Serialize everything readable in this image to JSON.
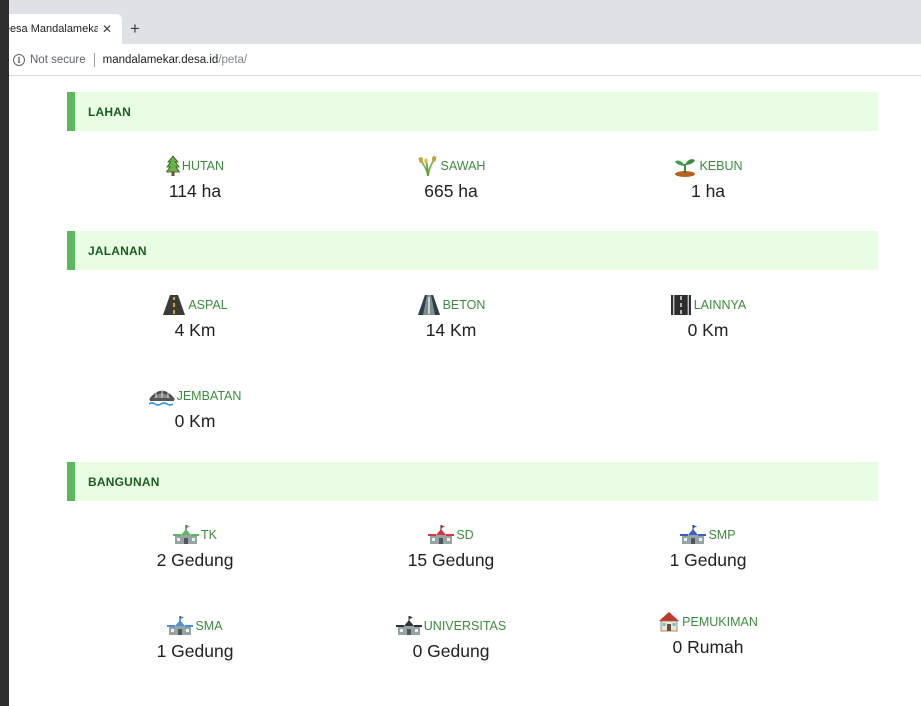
{
  "browser": {
    "tab_title": "Desa Mandalamekar",
    "tab_close": "✕",
    "new_tab": "+",
    "security_text": "Not secure",
    "url_host": "mandalamekar.desa.id",
    "url_path": "/peta/"
  },
  "sections": {
    "lahan": {
      "title": "LAHAN",
      "items": [
        {
          "label": "HUTAN",
          "value": "114 ha",
          "icon": "tree-icon"
        },
        {
          "label": "SAWAH",
          "value": "665 ha",
          "icon": "rice-plant-icon"
        },
        {
          "label": "KEBUN",
          "value": "1 ha",
          "icon": "sprout-icon"
        }
      ]
    },
    "jalanan": {
      "title": "JALANAN",
      "items": [
        {
          "label": "ASPAL",
          "value": "4 Km",
          "icon": "road-icon"
        },
        {
          "label": "BETON",
          "value": "14 Km",
          "icon": "road-icon"
        },
        {
          "label": "LAINNYA",
          "value": "0 Km",
          "icon": "road-icon"
        },
        {
          "label": "JEMBATAN",
          "value": "0 Km",
          "icon": "bridge-icon"
        }
      ]
    },
    "bangunan": {
      "title": "BANGUNAN",
      "items": [
        {
          "label": "TK",
          "value": "2 Gedung",
          "icon": "school-icon",
          "roof": "#5cb85c"
        },
        {
          "label": "SD",
          "value": "15 Gedung",
          "icon": "school-icon",
          "roof": "#d9363e"
        },
        {
          "label": "SMP",
          "value": "1 Gedung",
          "icon": "school-icon",
          "roof": "#3a5fc8"
        },
        {
          "label": "SMA",
          "value": "1 Gedung",
          "icon": "school-icon",
          "roof": "#4a90d9"
        },
        {
          "label": "UNIVERSITAS",
          "value": "0 Gedung",
          "icon": "school-icon",
          "roof": "#333333"
        },
        {
          "label": "PEMUKIMAN",
          "value": "0 Rumah",
          "icon": "house-icon",
          "roof": "#c0392b"
        }
      ]
    }
  },
  "colors": {
    "section_bg": "#e9fde5",
    "section_accent": "#5cb85c",
    "label_green": "#3c8c3f"
  }
}
